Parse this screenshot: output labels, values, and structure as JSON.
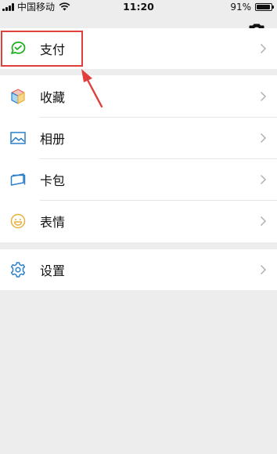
{
  "status_bar": {
    "carrier": "中国移动",
    "time": "11:20",
    "battery": "91%"
  },
  "menu": {
    "pay": {
      "label": "支付",
      "icon": "wechat-pay-icon"
    },
    "favorites": {
      "label": "收藏",
      "icon": "favorites-cube-icon"
    },
    "album": {
      "label": "相册",
      "icon": "album-image-icon"
    },
    "cards": {
      "label": "卡包",
      "icon": "card-wallet-icon"
    },
    "stickers": {
      "label": "表情",
      "icon": "smiley-icon"
    },
    "settings": {
      "label": "设置",
      "icon": "gear-icon"
    }
  },
  "colors": {
    "background": "#ededed",
    "highlight": "#e0403c",
    "pay_green": "#1aad19",
    "icon_blue": "#2c7fc9",
    "icon_yellow": "#e8b13e"
  }
}
